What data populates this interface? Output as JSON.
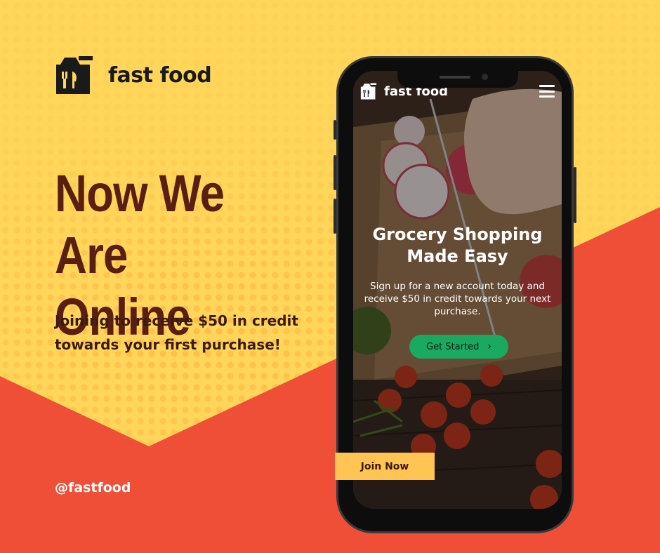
{
  "brand": {
    "name": "fast food",
    "logo_icon": "grocery-bag-icon"
  },
  "headline": {
    "line1": "Now We",
    "line2": "Are Online"
  },
  "subtext": {
    "line1": "Joining to receive $50 in credit",
    "line2": "towards your first purchase!"
  },
  "social_handle": "@fastfood",
  "phone": {
    "brand_name": "fast food",
    "menu_icon": "hamburger-menu-icon",
    "hero_title_line1": "Grocery Shopping",
    "hero_title_line2": "Made Easy",
    "hero_sub_line1": "Sign up for a new account today and",
    "hero_sub_line2": "receive $50 in credit towards your next",
    "hero_sub_line3": "purchase.",
    "cta_label": "Get Started",
    "cta_icon": "chevron-right-icon"
  },
  "join_button": {
    "label": "Join Now"
  },
  "colors": {
    "background_yellow": "#ffd65a",
    "background_red": "#f04f37",
    "headline": "#5a1e12",
    "cta_green": "#1aa960",
    "join_button": "#ffc452"
  }
}
